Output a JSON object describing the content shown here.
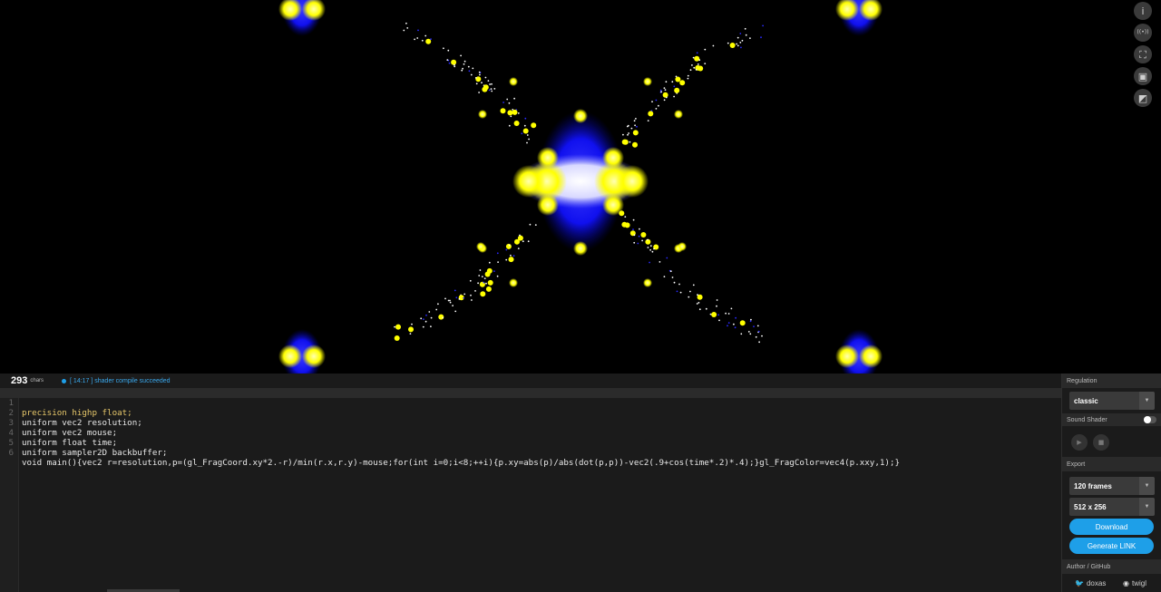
{
  "canvas": {
    "colors": {
      "background": "#000000",
      "yellow": "#ffff00",
      "blue": "#1010ff",
      "white": "#ffffff"
    },
    "side_icons": [
      "info-icon",
      "broadcast-icon",
      "fullscreen-icon",
      "hide-editor-icon",
      "layout-icon"
    ],
    "side_glyphs": [
      "i",
      "((•))",
      "⛶",
      "▣",
      "◩"
    ]
  },
  "editor": {
    "chars_count": "293",
    "chars_label": "chars",
    "status_message": "[ 14:17 ] shader compile succeeded",
    "lines": [
      "precision highp float;",
      "uniform vec2 resolution;",
      "uniform vec2 mouse;",
      "uniform float time;",
      "uniform sampler2D backbuffer;",
      "void main(){vec2 r=resolution,p=(gl_FragCoord.xy*2.-r)/min(r.x,r.y)-mouse;for(int i=0;i<8;++i){p.xy=abs(p)/abs(dot(p,p))-vec2(.9+cos(time*.2)*.4);}gl_FragColor=vec4(p.xxy,1);}"
    ],
    "line_numbers": [
      "1",
      "2",
      "3",
      "4",
      "5",
      "6"
    ]
  },
  "panel": {
    "regulation_header": "Regulation",
    "regulation_value": "classic",
    "sound_header": "Sound Shader",
    "play_glyph": "▶",
    "stop_glyph": "■",
    "export_header": "Export",
    "frames_value": "120 frames",
    "size_value": "512 x 256",
    "download_label": "Download",
    "generate_label": "Generate LINK",
    "author_header": "Author / GitHub",
    "author_name": "doxas",
    "repo_name": "twigl",
    "arrow_glyph": "▼",
    "twitter_glyph": "🐦",
    "github_glyph": "◉"
  }
}
